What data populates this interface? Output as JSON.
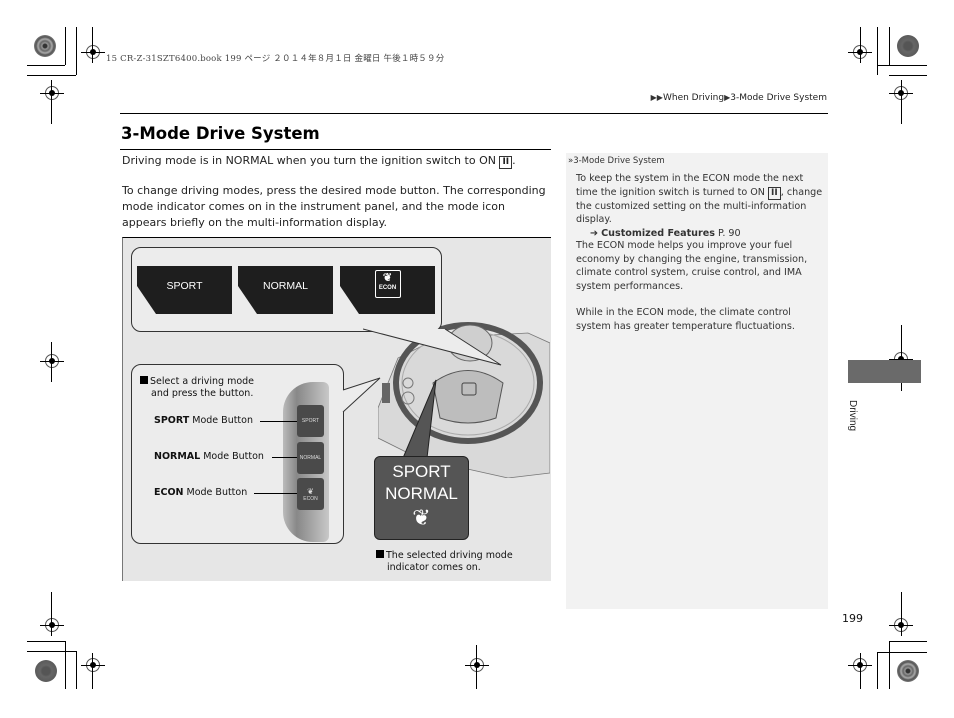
{
  "slug": "15 CR-Z-31SZT6400.book  199 ページ  ２０１４年８月１日  金曜日  午後１時５９分",
  "breadcrumb": {
    "items": [
      "When Driving",
      "3-Mode Drive System"
    ]
  },
  "page_title": "3-Mode Drive System",
  "intro": {
    "p1_before": "Driving mode is in NORMAL when you turn the ignition switch to ON ",
    "p1_key": "II",
    "p1_after": ".",
    "p2": "To change driving modes, press the desired mode button. The corresponding mode indicator comes on in the instrument panel, and the mode icon appears briefly on the multi-information display."
  },
  "sidebar": {
    "heading": "3-Mode Drive System",
    "p1_before": "To keep the system in the ECON mode the next time the ignition switch is turned to ON ",
    "p1_key": "II",
    "p1_after": ", change the customized setting on the multi-information display.",
    "xref_label": "Customized Features",
    "xref_page": "P. 90",
    "p2": "The ECON mode helps you improve your fuel economy by changing the engine, transmission, climate control system, cruise control, and IMA system performances.",
    "p3": "While in the ECON mode, the climate control system has greater temperature fluctuations."
  },
  "figure": {
    "display_tiles": [
      "SPORT",
      "NORMAL",
      "ECON"
    ],
    "select_caption_line1": "Select a driving mode",
    "select_caption_line2": "and press the button.",
    "buttons": [
      {
        "bold": "SPORT",
        "rest": " Mode Button",
        "label": "SPORT"
      },
      {
        "bold": "NORMAL",
        "rest": " Mode Button",
        "label": "NORMAL"
      },
      {
        "bold": "ECON",
        "rest": " Mode Button",
        "label": "ECON"
      }
    ],
    "indicator_lines": [
      "SPORT",
      "NORMAL"
    ],
    "indicator_caption_line1": "The selected driving mode",
    "indicator_caption_line2": "indicator comes on."
  },
  "side_tab": "Driving",
  "page_number": "199"
}
